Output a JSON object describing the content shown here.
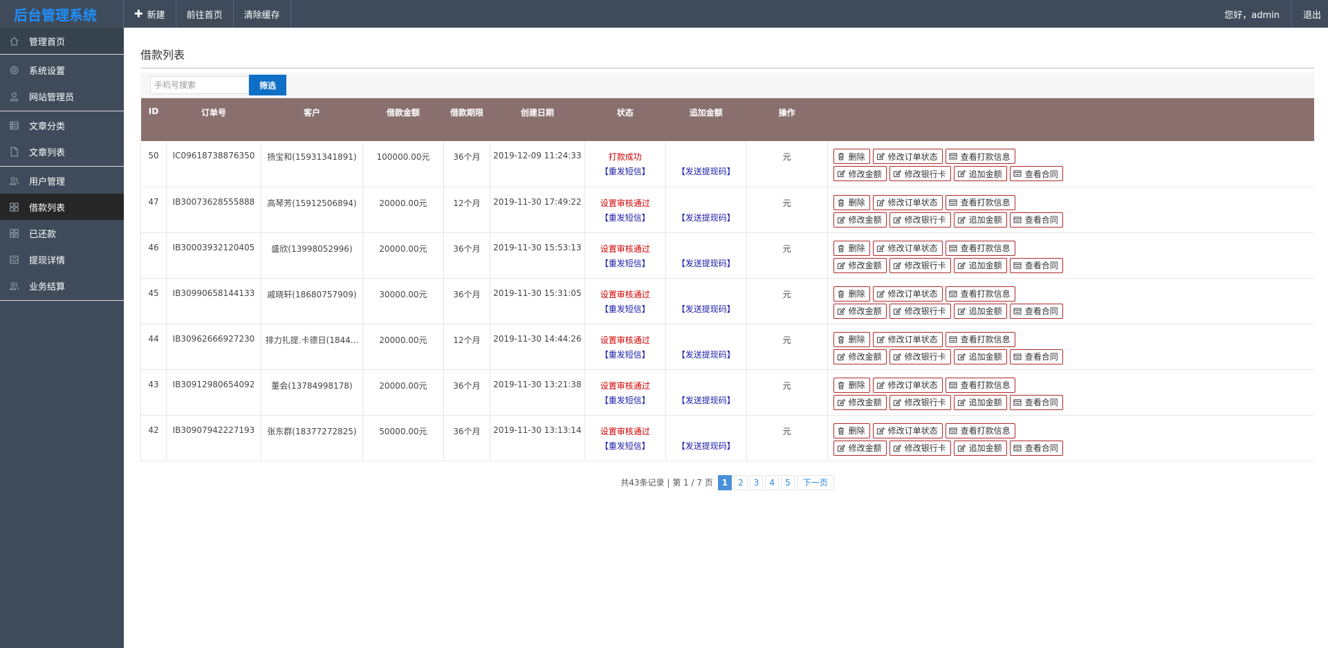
{
  "app": {
    "title": "后台管理系统"
  },
  "topnav": {
    "new_label": "新建",
    "home_label": "前往首页",
    "clear_cache_label": "清除缓存",
    "greeting": "您好，admin",
    "logout_label": "退出"
  },
  "sidebar": {
    "items": [
      {
        "label": "管理首页",
        "icon": "home-icon"
      },
      {
        "label": "系统设置",
        "icon": "gear-icon"
      },
      {
        "label": "网站管理员",
        "icon": "user-icon"
      },
      {
        "label": "文章分类",
        "icon": "category-icon"
      },
      {
        "label": "文章列表",
        "icon": "document-icon"
      },
      {
        "label": "用户管理",
        "icon": "users-icon"
      },
      {
        "label": "借款列表",
        "icon": "grid-icon"
      },
      {
        "label": "已还款",
        "icon": "grid-icon"
      },
      {
        "label": "提现详情",
        "icon": "inbox-icon"
      },
      {
        "label": "业务结算",
        "icon": "users-icon"
      }
    ]
  },
  "main": {
    "title": "借款列表",
    "search": {
      "placeholder": "手机号搜索",
      "button_label": "筛选"
    },
    "columns": [
      "ID",
      "订单号",
      "客户",
      "借款金额",
      "借款期限",
      "创建日期",
      "状态",
      "追加金额",
      "操作"
    ],
    "rows": [
      {
        "id": "50",
        "order": "IC09618738876350",
        "customer": "扬宝和(15931341891)",
        "amount": "100000.00元",
        "term": "36个月",
        "date": "2019-12-09 11:24:33",
        "status": "打款成功",
        "resend": "【重发短信】",
        "extra": "【发送提现码】",
        "unit": "元"
      },
      {
        "id": "47",
        "order": "IB30073628555888",
        "customer": "高琴芳(15912506894)",
        "amount": "20000.00元",
        "term": "12个月",
        "date": "2019-11-30 17:49:22",
        "status": "设置审核通过",
        "resend": "【重发短信】",
        "extra": "【发送提现码】",
        "unit": "元"
      },
      {
        "id": "46",
        "order": "IB30003932120405",
        "customer": "盛欣(13998052996)",
        "amount": "20000.00元",
        "term": "36个月",
        "date": "2019-11-30 15:53:13",
        "status": "设置审核通过",
        "resend": "【重发短信】",
        "extra": "【发送提现码】",
        "unit": "元"
      },
      {
        "id": "45",
        "order": "IB30990658144133",
        "customer": "戚晓轩(18680757909)",
        "amount": "30000.00元",
        "term": "36个月",
        "date": "2019-11-30 15:31:05",
        "status": "设置审核通过",
        "resend": "【重发短信】",
        "extra": "【发送提现码】",
        "unit": "元"
      },
      {
        "id": "44",
        "order": "IB30962666927230",
        "customer": "排力扎提.卡德日(1844...",
        "amount": "20000.00元",
        "term": "12个月",
        "date": "2019-11-30 14:44:26",
        "status": "设置审核通过",
        "resend": "【重发短信】",
        "extra": "【发送提现码】",
        "unit": "元"
      },
      {
        "id": "43",
        "order": "IB30912980654092",
        "customer": "董会(13784998178)",
        "amount": "20000.00元",
        "term": "36个月",
        "date": "2019-11-30 13:21:38",
        "status": "设置审核通过",
        "resend": "【重发短信】",
        "extra": "【发送提现码】",
        "unit": "元"
      },
      {
        "id": "42",
        "order": "IB30907942227193",
        "customer": "张东群(18377272825)",
        "amount": "50000.00元",
        "term": "36个月",
        "date": "2019-11-30 13:13:14",
        "status": "设置审核通过",
        "resend": "【重发短信】",
        "extra": "【发送提现码】",
        "unit": "元"
      }
    ],
    "ops": {
      "delete": "删除",
      "edit_status": "修改订单状态",
      "view_payment": "查看打款信息",
      "edit_amount": "修改金额",
      "edit_card": "修改银行卡",
      "add_amount": "追加金额",
      "view_contract": "查看合同"
    },
    "pagination": {
      "info": "共43条记录 | 第 1 / 7 页",
      "pages": [
        "1",
        "2",
        "3",
        "4",
        "5"
      ],
      "current": "1",
      "next_label": "下一页"
    }
  },
  "colors": {
    "topbar": "#3f4b5b",
    "logo": "#1e90ff",
    "table_header": "#89706e",
    "status_red": "#d30000",
    "link_blue": "#1a1aa8",
    "button_blue": "#0f6fc6",
    "op_border": "#b12626"
  }
}
